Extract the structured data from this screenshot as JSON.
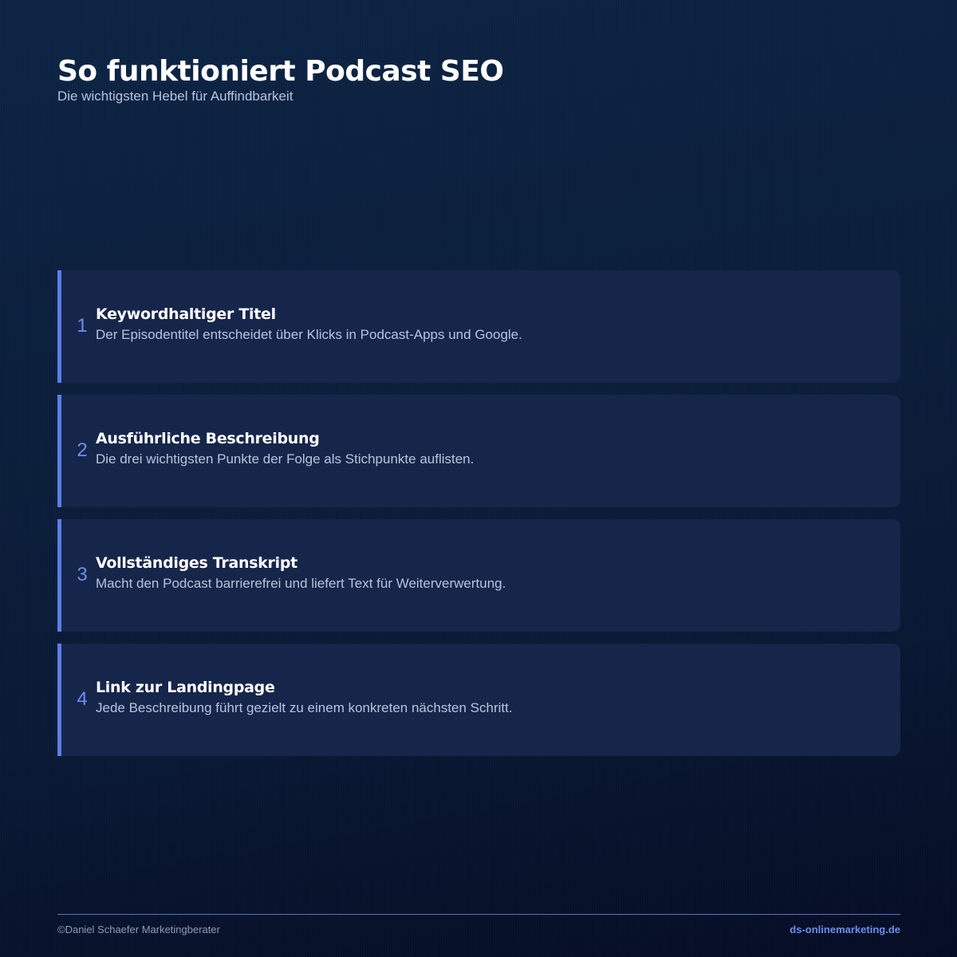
{
  "header": {
    "title": "So funktioniert Podcast SEO",
    "subtitle": "Die wichtigsten Hebel für Auffindbarkeit"
  },
  "items": [
    {
      "number": "1",
      "title": "Keywordhaltiger Titel",
      "description": "Der Episodentitel entscheidet über Klicks in Podcast-Apps und Google."
    },
    {
      "number": "2",
      "title": "Ausführliche Beschreibung",
      "description": "Die drei wichtigsten Punkte der Folge als Stichpunkte auflisten."
    },
    {
      "number": "3",
      "title": "Vollständiges Transkript",
      "description": "Macht den Podcast barrierefrei und liefert Text für Weiterverwertung."
    },
    {
      "number": "4",
      "title": "Link zur Landingpage",
      "description": "Jede Beschreibung führt gezielt zu einem konkreten nächsten Schritt."
    }
  ],
  "footer": {
    "copyright": "©Daniel Schaefer Marketingberater",
    "website": "ds-onlinemarketing.de"
  },
  "colors": {
    "background": "#0b1f3c",
    "card": "#16254a",
    "accent": "#5b7ee5",
    "accent_text": "#6b8ff0",
    "muted_text": "#b7c4de"
  }
}
